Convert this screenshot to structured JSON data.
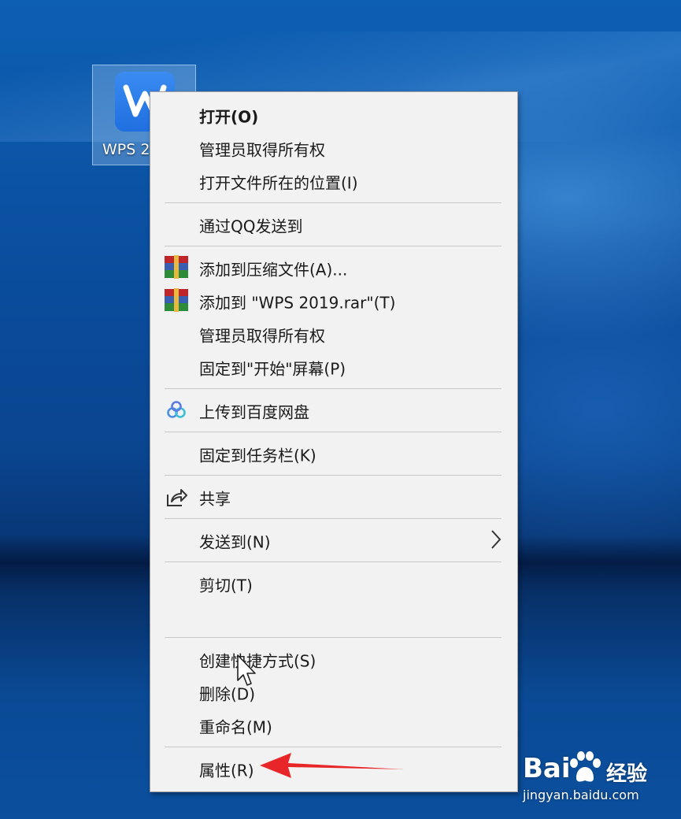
{
  "desktop": {
    "icon_label": "WPS 2"
  },
  "menu": {
    "items": [
      {
        "label": "打开(O)"
      },
      {
        "label": "管理员取得所有权"
      },
      {
        "label": "打开文件所在的位置(I)"
      },
      {
        "label": "通过QQ发送到"
      },
      {
        "label": "添加到压缩文件(A)..."
      },
      {
        "label": "添加到 \"WPS 2019.rar\"(T)"
      },
      {
        "label": "管理员取得所有权"
      },
      {
        "label": "固定到\"开始\"屏幕(P)"
      },
      {
        "label": "上传到百度网盘"
      },
      {
        "label": "固定到任务栏(K)"
      },
      {
        "label": "共享"
      },
      {
        "label": "发送到(N)"
      },
      {
        "label": "剪切(T)"
      },
      {
        "label": "创建快捷方式(S)"
      },
      {
        "label": "删除(D)"
      },
      {
        "label": "重命名(M)"
      },
      {
        "label": "属性(R)"
      }
    ]
  },
  "watermark": {
    "brand": "Bai",
    "brand_suffix": "经验",
    "url": "jingyan.baidu.com"
  },
  "colors": {
    "menu_bg": "#f2f2f2",
    "annotation_arrow": "#e8262a",
    "wps_blue": "#2b7de9"
  }
}
